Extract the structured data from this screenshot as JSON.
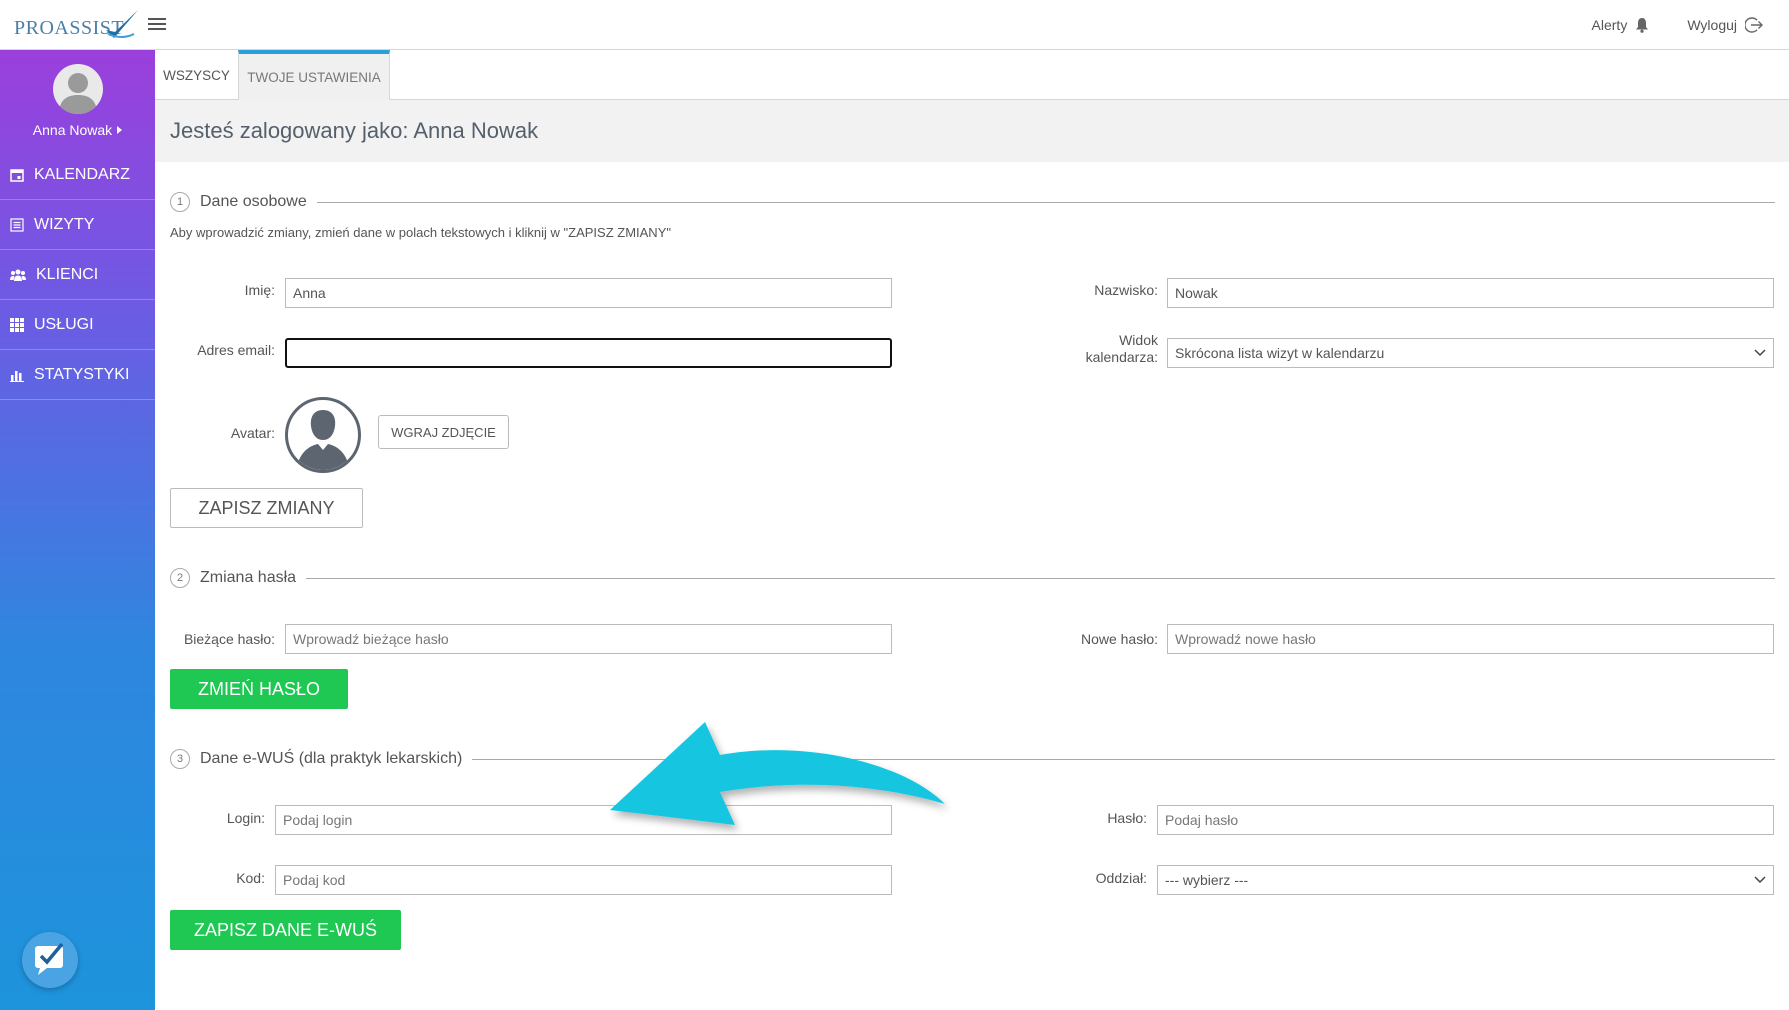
{
  "app": {
    "logo_text": "PROASSIST"
  },
  "topbar": {
    "alerts_label": "Alerty",
    "logout_label": "Wyloguj"
  },
  "sidebar": {
    "user_name": "Anna Nowak",
    "items": [
      {
        "label": "KALENDARZ",
        "icon": "calendar-icon"
      },
      {
        "label": "WIZYTY",
        "icon": "list-icon"
      },
      {
        "label": "KLIENCI",
        "icon": "clients-icon"
      },
      {
        "label": "USŁUGI",
        "icon": "grid-icon"
      },
      {
        "label": "STATYSTYKI",
        "icon": "chart-icon"
      }
    ]
  },
  "tabs": [
    {
      "label": "WSZYSCY",
      "active": false
    },
    {
      "label": "TWOJE USTAWIENIA",
      "active": true
    }
  ],
  "header": {
    "title": "Jesteś zalogowany jako: Anna Nowak"
  },
  "section1": {
    "number": "1",
    "title": "Dane osobowe",
    "hint": "Aby wprowadzić zmiany, zmień dane w polach tekstowych i kliknij w \"ZAPISZ ZMIANY\"",
    "first_name_label": "Imię:",
    "first_name_value": "Anna",
    "last_name_label": "Nazwisko:",
    "last_name_value": "Nowak",
    "email_label": "Adres email:",
    "email_value": "",
    "view_label_1": "Widok",
    "view_label_2": "kalendarza:",
    "view_value": "Skrócona lista wizyt w kalendarzu",
    "avatar_label": "Avatar:",
    "upload_label": "WGRAJ ZDJĘCIE",
    "save_label": "ZAPISZ ZMIANY"
  },
  "section2": {
    "number": "2",
    "title": "Zmiana hasła",
    "current_label": "Bieżące hasło:",
    "current_placeholder": "Wprowadź bieżące hasło",
    "new_label": "Nowe hasło:",
    "new_placeholder": "Wprowadź nowe hasło",
    "change_label": "ZMIEŃ HASŁO"
  },
  "section3": {
    "number": "3",
    "title": "Dane e-WUŚ (dla praktyk lekarskich)",
    "login_label": "Login:",
    "login_placeholder": "Podaj login",
    "password_label": "Hasło:",
    "password_placeholder": "Podaj hasło",
    "code_label": "Kod:",
    "code_placeholder": "Podaj kod",
    "branch_label": "Oddział:",
    "branch_value": "--- wybierz ---",
    "save_label": "ZAPISZ DANE E-WUŚ"
  },
  "colors": {
    "accent_green": "#1ec853",
    "tab_accent": "#2a9fd8",
    "annotation_arrow": "#19c6e0"
  }
}
